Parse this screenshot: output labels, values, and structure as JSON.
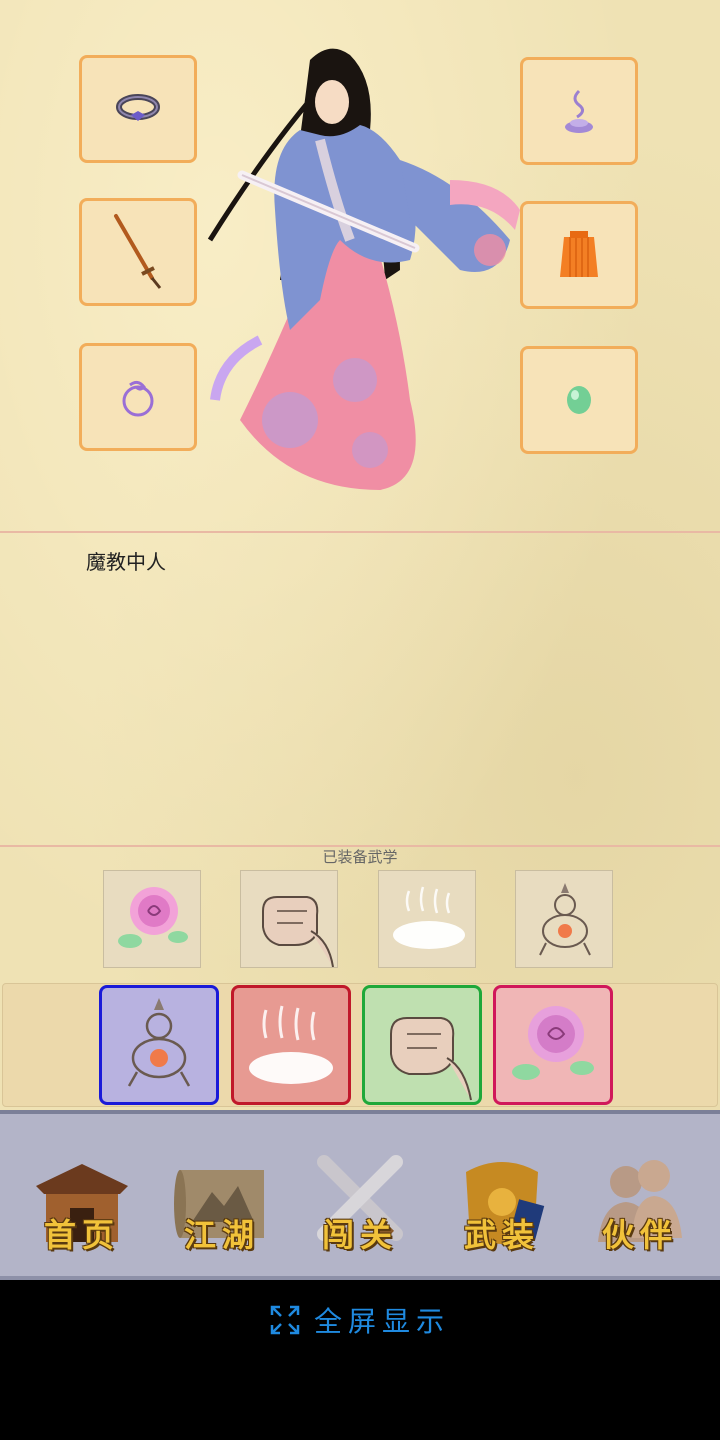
{
  "character": {
    "name": "魔教中人"
  },
  "equipment_slots": [
    {
      "name": "bracelet-icon"
    },
    {
      "name": "incense-icon"
    },
    {
      "name": "sword-icon"
    },
    {
      "name": "robe-icon"
    },
    {
      "name": "ring-icon"
    },
    {
      "name": "jade-icon"
    }
  ],
  "skills": {
    "equipped_label": "已装备武学",
    "equipped": [
      {
        "icon": "rose-icon"
      },
      {
        "icon": "fist-icon"
      },
      {
        "icon": "mist-icon"
      },
      {
        "icon": "gourd-icon"
      }
    ],
    "available": [
      {
        "icon": "gourd-icon",
        "border": "#1a1ad8",
        "bg": "#b8b2e0"
      },
      {
        "icon": "mist-icon",
        "border": "#c0182a",
        "bg": "#e79a92"
      },
      {
        "icon": "fist-icon",
        "border": "#1fa83a",
        "bg": "#bfe0b0"
      },
      {
        "icon": "rose-icon",
        "border": "#d0185a",
        "bg": "#f0b6b6"
      }
    ]
  },
  "nav": {
    "items": [
      {
        "label": "首页",
        "icon": "house-icon"
      },
      {
        "label": "江湖",
        "icon": "scroll-icon"
      },
      {
        "label": "闯关",
        "icon": "crossed-swords-icon"
      },
      {
        "label": "武装",
        "icon": "armor-icon"
      },
      {
        "label": "伙伴",
        "icon": "companions-icon"
      }
    ]
  },
  "fullscreen": {
    "label": "全屏显示",
    "icon": "expand-icon",
    "color": "#1f8ae0"
  }
}
